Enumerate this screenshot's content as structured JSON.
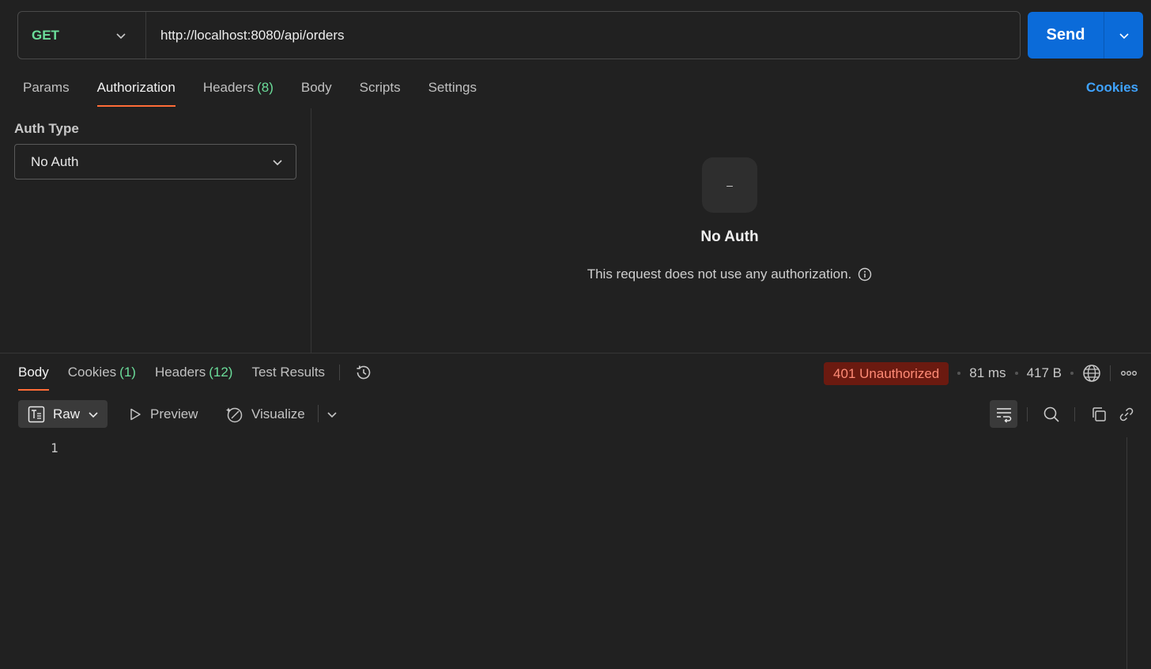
{
  "request": {
    "method": "GET",
    "url": "http://localhost:8080/api/orders",
    "send_label": "Send"
  },
  "request_tabs": [
    {
      "label": "Params"
    },
    {
      "label": "Authorization"
    },
    {
      "label": "Headers",
      "count": "(8)"
    },
    {
      "label": "Body"
    },
    {
      "label": "Scripts"
    },
    {
      "label": "Settings"
    }
  ],
  "cookies_link": "Cookies",
  "auth": {
    "type_label": "Auth Type",
    "selected": "No Auth",
    "icon_glyph": "–",
    "title": "No Auth",
    "description": "This request does not use any authorization."
  },
  "response_tabs": [
    {
      "label": "Body"
    },
    {
      "label": "Cookies",
      "count": "(1)"
    },
    {
      "label": "Headers",
      "count": "(12)"
    },
    {
      "label": "Test Results"
    }
  ],
  "response_meta": {
    "status": "401 Unauthorized",
    "time": "81 ms",
    "size": "417 B"
  },
  "response_toolbar": {
    "raw_label": "Raw",
    "preview_label": "Preview",
    "visualize_label": "Visualize"
  },
  "editor": {
    "line_numbers": [
      "1"
    ]
  },
  "colors": {
    "accent_orange": "#ff6c37",
    "method_green": "#6bdd9a",
    "send_blue": "#0b6bd9",
    "link_blue": "#3fa3ff",
    "status_error_bg": "#6b1a10",
    "status_error_text": "#ff8b76"
  }
}
